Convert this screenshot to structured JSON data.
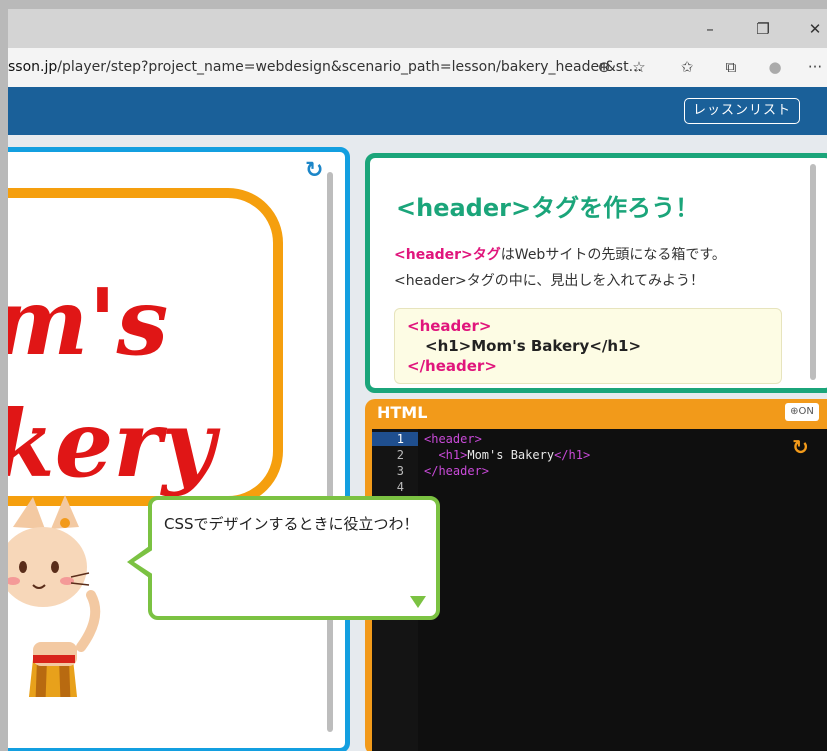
{
  "browser": {
    "url_prefix": "sson.jp",
    "url_path": "/player/step?project_name=webdesign&scenario_path=lesson/bakery_header&st...",
    "minimize_icon": "–",
    "restore_icon": "❐",
    "close_icon": "✕",
    "zoom_icon": "⊕",
    "star_icon": "☆",
    "favorites_icon": "✩",
    "collections_icon": "⧉",
    "profile_icon": "●",
    "more_icon": "···"
  },
  "header": {
    "lesson_list": "レッスンリスト"
  },
  "preview": {
    "line1": "m's",
    "line2": "kery",
    "refresh_icon": "↻"
  },
  "bubble": {
    "text": "CSSでデザインするときに役立つわ！"
  },
  "instructions": {
    "title": "<header>タグを作ろう！",
    "line1_tag": "<header>",
    "line1_tag2": "タグ",
    "line1_rest": "はWebサイトの先頭になる箱です。",
    "line2": "<header>タグの中に、見出しを入れてみよう！",
    "code": {
      "line1": "<header>",
      "line2": "<h1>Mom's Bakery</h1>",
      "line3": "</header>"
    }
  },
  "editor": {
    "title": "HTML",
    "zoom_label": "⊕ON",
    "refresh_icon": "↻",
    "line_numbers": [
      "1",
      "2",
      "3",
      "4"
    ],
    "line1_tag": "<header>",
    "line2_open": "<h1>",
    "line2_text": "Mom's Bakery",
    "line2_close": "</h1>",
    "line3_tag": "</header>"
  }
}
